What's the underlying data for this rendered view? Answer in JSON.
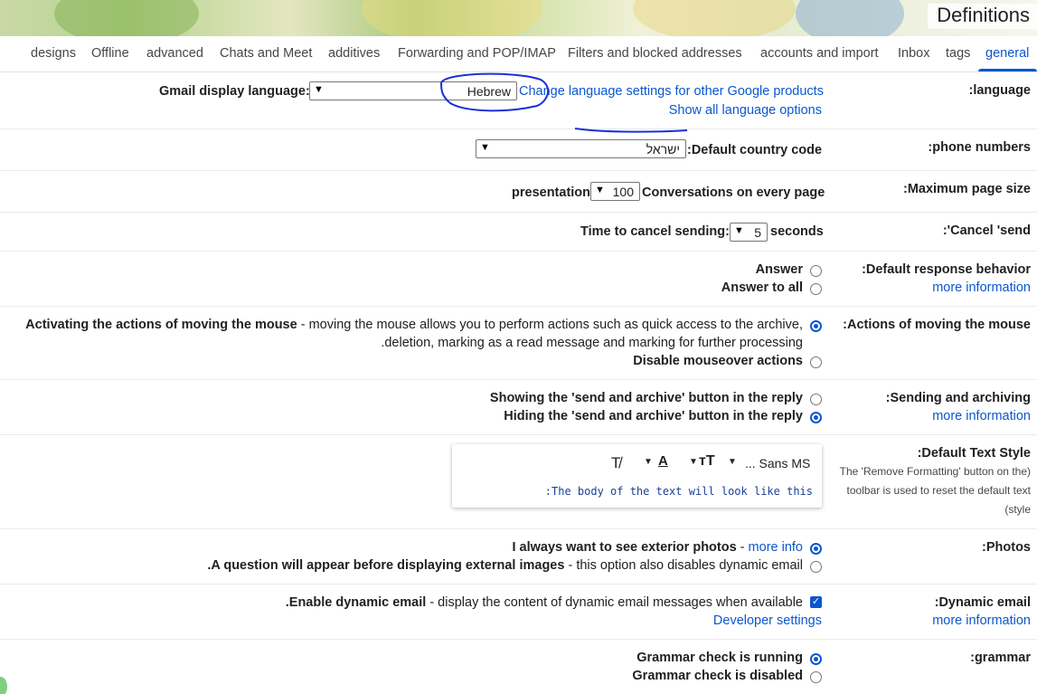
{
  "header": {
    "title": "Definitions"
  },
  "tabs": [
    "designs",
    "Offline",
    "advanced",
    "Chats and Meet",
    "additives",
    "Forwarding and POP/IMAP",
    "Filters and blocked addresses",
    "accounts and import",
    "Inbox",
    "tags",
    "general"
  ],
  "active_tab": "general",
  "colors": {
    "accent": "#0b57d0",
    "annotation_ink": "#1c2fd8"
  },
  "language": {
    "label": ":language",
    "display_label": "Gmail display language:",
    "selected": "Hebrew",
    "change_link": "Change language settings for other Google products",
    "show_all_link": "Show all language options"
  },
  "phone": {
    "label": ":phone numbers",
    "field_label": ":Default country code",
    "selected": "ישראל"
  },
  "page_size": {
    "label": ":Maximum page size",
    "prefix": "presentation",
    "selected": "100",
    "suffix": "Conversations on every page"
  },
  "cancel_send": {
    "label": ":'Cancel 'send",
    "prefix": "Time to cancel sending:",
    "selected": "5",
    "suffix": "seconds"
  },
  "response": {
    "label": ":Default response behavior",
    "more": "more information",
    "options": [
      "Answer",
      "Answer to all"
    ],
    "selected_index": -1
  },
  "mouse": {
    "label": ":Actions of moving the mouse",
    "option1_bold": "Activating the actions of moving the mouse",
    "option1_desc": " - moving the mouse allows you to perform actions such as quick access to the archive,",
    "option1_desc2": ".deletion, marking as a read message and marking for further processing",
    "option2": "Disable mouseover actions",
    "selected_index": 0
  },
  "send_archive": {
    "label": ":Sending and archiving",
    "more": "more information",
    "options": [
      "Showing the 'send and archive' button in the reply",
      "Hiding the 'send and archive' button in the reply"
    ],
    "selected_index": 1
  },
  "text_style": {
    "label": ":Default Text Style",
    "note_lines": [
      "The 'Remove Formatting' button on the)",
      "toolbar is used to reset the default text",
      "(style"
    ],
    "font": "... Sans MS",
    "preview": ":The body of the text will look like this"
  },
  "photos": {
    "label": ":Photos",
    "option1_bold": "I always want to see exterior photos",
    "option1_sep": " - ",
    "option1_link": "more info",
    "option2_bold": ".A question will appear before displaying external images",
    "option2_desc": " - this option also disables dynamic email",
    "selected_index": 0
  },
  "dynamic": {
    "label": ":Dynamic email",
    "more": "more information",
    "checkbox_bold": ".Enable dynamic email",
    "checkbox_desc": " - display the content of dynamic email messages when available",
    "checked": true,
    "dev_link": "Developer settings"
  },
  "grammar": {
    "label": ":grammar",
    "options": [
      "Grammar check is running",
      "Grammar check is disabled"
    ],
    "selected_index": 0
  }
}
